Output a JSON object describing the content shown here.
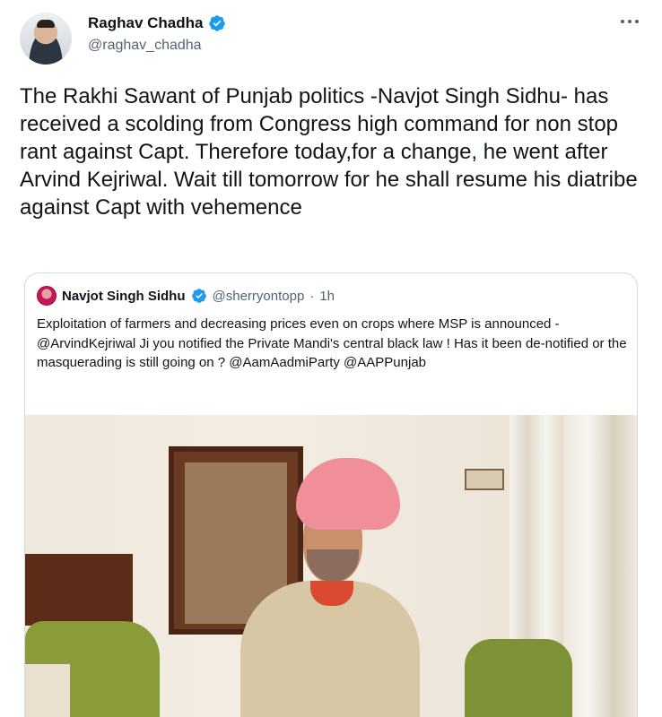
{
  "author": {
    "name": "Raghav Chadha",
    "handle": "@raghav_chadha"
  },
  "tweet": {
    "text": "The Rakhi Sawant of Punjab politics -Navjot Singh Sidhu- has received a scolding from Congress high command for non stop rant against Capt. Therefore today,for a change, he went after Arvind Kejriwal. Wait till tomorrow for he shall resume his diatribe against Capt with vehemence"
  },
  "quoted": {
    "name": "Navjot Singh Sidhu",
    "handle": "@sherryontopp",
    "dot": "·",
    "time": "1h",
    "text": "Exploitation of farmers and decreasing prices even on crops where MSP is announced - @ArvindKejriwal Ji you notified the Private Mandi's central black law ! Has it been de-notified or the masquerading is still going on ? @AamAadmiParty @AAPPunjab"
  },
  "icons": {
    "verified": "verified-badge-icon",
    "more": "more-options-icon"
  },
  "colors": {
    "verified": "#1d9bf0",
    "secondary_text": "#536471",
    "border": "#cfd9de"
  }
}
